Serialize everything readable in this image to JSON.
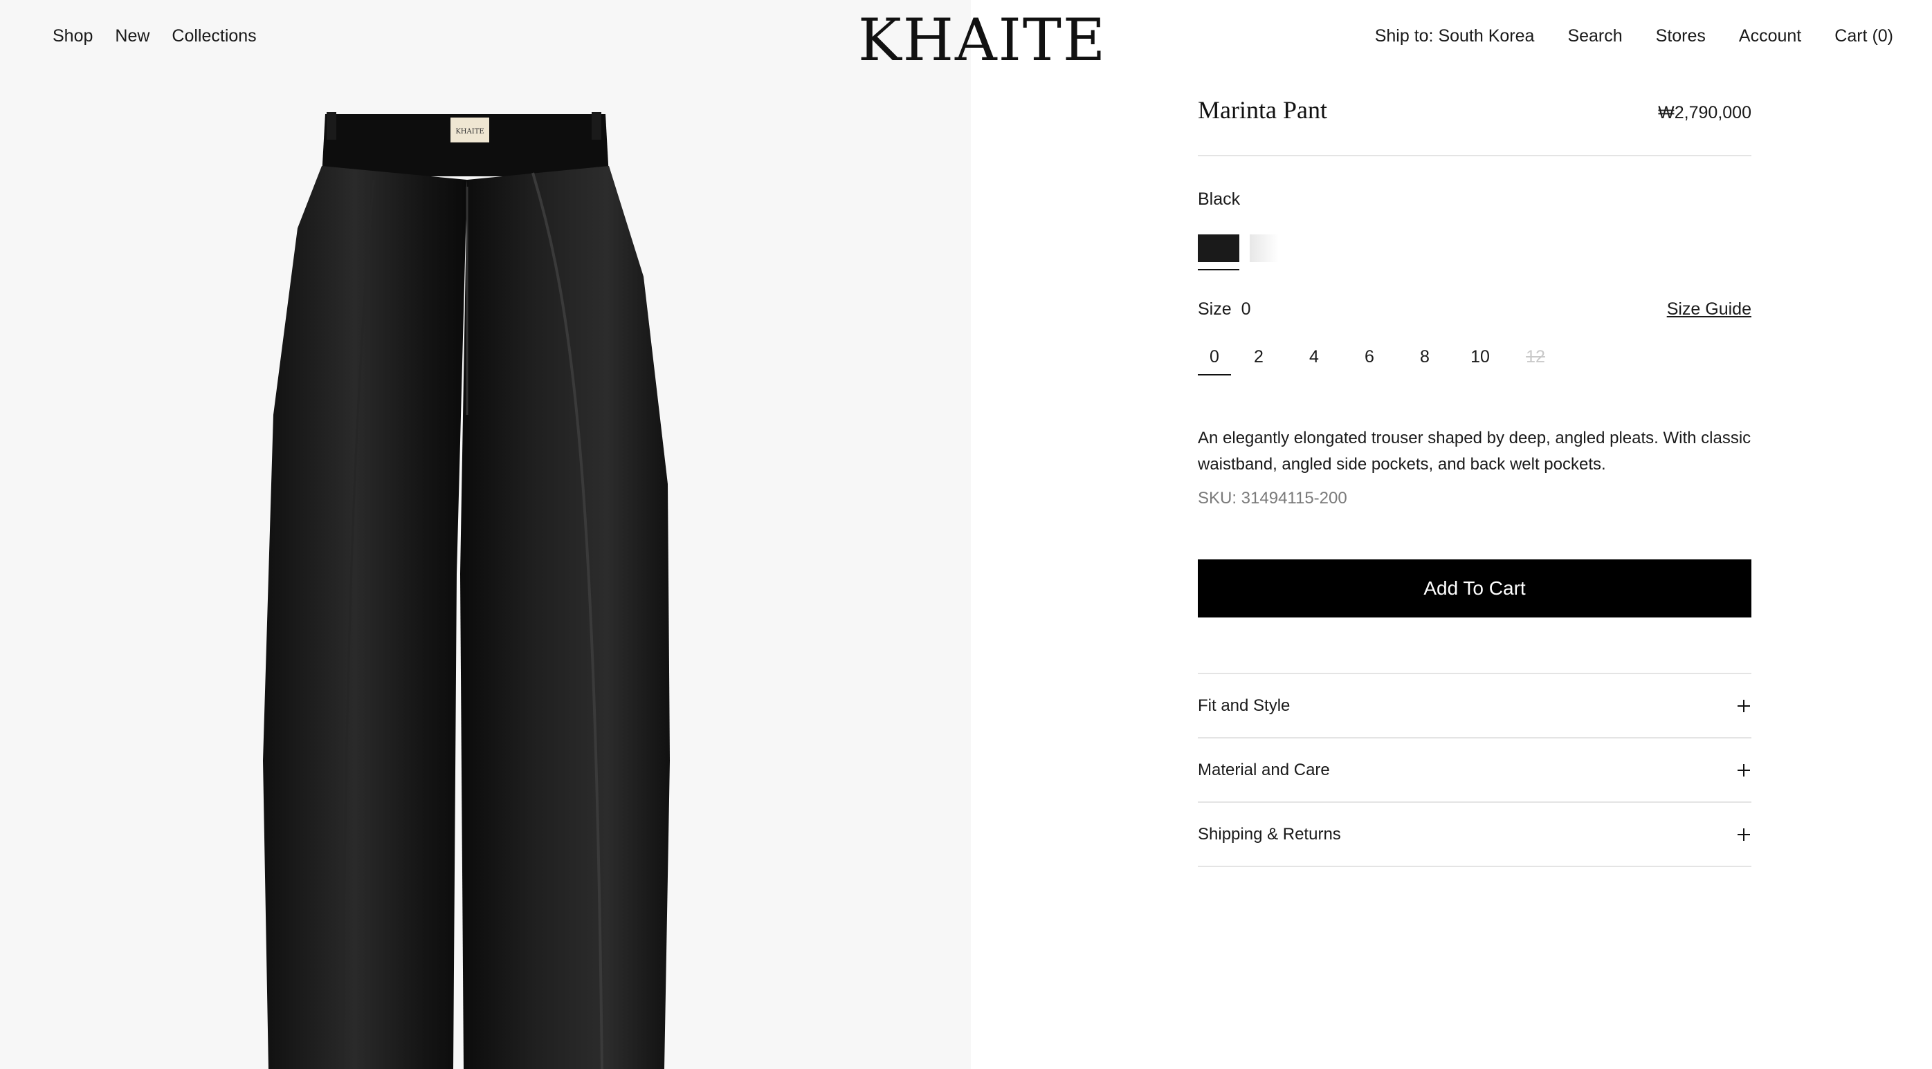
{
  "header": {
    "nav_left": [
      "Shop",
      "New",
      "Collections"
    ],
    "logo": "KHAITE",
    "nav_right": [
      "Ship to: South Korea",
      "Search",
      "Stores",
      "Account",
      "Cart (0)"
    ]
  },
  "product": {
    "title": "Marinta Pant",
    "price": "₩2,790,000",
    "color_label": "Black",
    "colors": [
      {
        "name": "black",
        "hex": "#1a1a1a",
        "selected": true
      },
      {
        "name": "white",
        "hex": "#ececec",
        "selected": false
      }
    ],
    "size_label": "Size",
    "size_current": "0",
    "size_guide": "Size Guide",
    "sizes": [
      {
        "label": "0",
        "selected": true,
        "available": true
      },
      {
        "label": "2",
        "selected": false,
        "available": true
      },
      {
        "label": "4",
        "selected": false,
        "available": true
      },
      {
        "label": "6",
        "selected": false,
        "available": true
      },
      {
        "label": "8",
        "selected": false,
        "available": true
      },
      {
        "label": "10",
        "selected": false,
        "available": true
      },
      {
        "label": "12",
        "selected": false,
        "available": false
      }
    ],
    "description": "An elegantly elongated trouser shaped by deep, angled pleats. With classic waistband, angled side pockets, and back welt pockets.",
    "sku": "SKU: 31494115-200",
    "add_to_cart": "Add To Cart",
    "accordion": [
      "Fit and Style",
      "Material and Care",
      "Shipping & Returns"
    ],
    "image_label": "KHAITE"
  }
}
